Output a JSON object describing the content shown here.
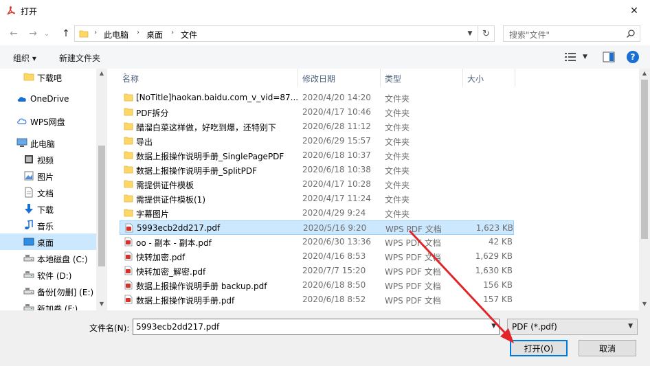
{
  "window": {
    "title": "打开",
    "close_glyph": "✕"
  },
  "nav": {
    "back_glyph": "←",
    "forward_glyph": "→",
    "recent_glyph": "⌄",
    "up_glyph": "↑"
  },
  "address": {
    "crumbs": [
      "此电脑",
      "桌面",
      "文件"
    ],
    "separator": "›",
    "refresh_glyph": "↻"
  },
  "search": {
    "placeholder": "搜索\"文件\""
  },
  "toolbar": {
    "organize_label": "组织 ▾",
    "new_folder_label": "新建文件夹",
    "help_label": "?"
  },
  "sidebar": {
    "items": [
      {
        "label": "下载吧",
        "icon": "folder-icon",
        "indent": 1
      },
      {
        "label": "OneDrive",
        "icon": "cloud-icon",
        "indent": 0
      },
      {
        "label": "WPS网盘",
        "icon": "cloud-outline-icon",
        "indent": 0
      },
      {
        "label": "此电脑",
        "icon": "computer-icon",
        "indent": 0
      },
      {
        "label": "视频",
        "icon": "video-icon",
        "indent": 1
      },
      {
        "label": "图片",
        "icon": "picture-icon",
        "indent": 1
      },
      {
        "label": "文档",
        "icon": "document-icon",
        "indent": 1
      },
      {
        "label": "下载",
        "icon": "download-icon",
        "indent": 1
      },
      {
        "label": "音乐",
        "icon": "music-icon",
        "indent": 1
      },
      {
        "label": "桌面",
        "icon": "desktop-icon",
        "indent": 1,
        "selected": true
      },
      {
        "label": "本地磁盘 (C:)",
        "icon": "drive-icon",
        "indent": 1
      },
      {
        "label": "软件 (D:)",
        "icon": "drive-icon",
        "indent": 1
      },
      {
        "label": "备份[勿删] (E:)",
        "icon": "drive-icon",
        "indent": 1
      },
      {
        "label": "新加卷 (F:)",
        "icon": "drive-icon",
        "indent": 1
      }
    ]
  },
  "columns": {
    "name": "名称",
    "date": "修改日期",
    "type": "类型",
    "size": "大小"
  },
  "files": [
    {
      "name": "[NoTitle]haokan.baidu.com_v_vid=87...",
      "date": "2020/4/20 14:20",
      "type": "文件夹",
      "size": "",
      "kind": "folder"
    },
    {
      "name": "PDF拆分",
      "date": "2020/4/17 10:46",
      "type": "文件夹",
      "size": "",
      "kind": "folder"
    },
    {
      "name": "醋溜白菜这样做，好吃到爆，还特别下",
      "date": "2020/6/28 11:12",
      "type": "文件夹",
      "size": "",
      "kind": "folder"
    },
    {
      "name": "导出",
      "date": "2020/6/29 15:57",
      "type": "文件夹",
      "size": "",
      "kind": "folder"
    },
    {
      "name": "数据上报操作说明手册_SinglePagePDF",
      "date": "2020/6/18 10:37",
      "type": "文件夹",
      "size": "",
      "kind": "folder"
    },
    {
      "name": "数据上报操作说明手册_SplitPDF",
      "date": "2020/6/18 10:38",
      "type": "文件夹",
      "size": "",
      "kind": "folder"
    },
    {
      "name": "需提供证件模板",
      "date": "2020/4/17 10:28",
      "type": "文件夹",
      "size": "",
      "kind": "folder"
    },
    {
      "name": "需提供证件模板(1)",
      "date": "2020/4/17 11:24",
      "type": "文件夹",
      "size": "",
      "kind": "folder"
    },
    {
      "name": "字幕图片",
      "date": "2020/4/29 9:24",
      "type": "文件夹",
      "size": "",
      "kind": "folder"
    },
    {
      "name": "5993ecb2dd217.pdf",
      "date": "2020/5/16 9:20",
      "type": "WPS PDF 文档",
      "size": "1,623 KB",
      "kind": "pdf",
      "selected": true
    },
    {
      "name": "oo - 副本 - 副本.pdf",
      "date": "2020/6/30 13:36",
      "type": "WPS PDF 文档",
      "size": "42 KB",
      "kind": "pdf"
    },
    {
      "name": "快转加密.pdf",
      "date": "2020/4/16 8:53",
      "type": "WPS PDF 文档",
      "size": "1,629 KB",
      "kind": "pdf"
    },
    {
      "name": "快转加密_解密.pdf",
      "date": "2020/7/7 15:20",
      "type": "WPS PDF 文档",
      "size": "1,630 KB",
      "kind": "pdf"
    },
    {
      "name": "数据上报操作说明手册 backup.pdf",
      "date": "2020/6/18 8:50",
      "type": "WPS PDF 文档",
      "size": "156 KB",
      "kind": "pdf"
    },
    {
      "name": "数据上报操作说明手册.pdf",
      "date": "2020/6/18 8:52",
      "type": "WPS PDF 文档",
      "size": "157 KB",
      "kind": "pdf"
    }
  ],
  "footer": {
    "filename_label": "文件名(N):",
    "filename_value": "5993ecb2dd217.pdf",
    "filetype_value": "PDF (*.pdf)",
    "open_label": "打开(O)",
    "cancel_label": "取消"
  },
  "colors": {
    "accent": "#0078d7",
    "selection": "#cce8ff",
    "folder": "#ffd766",
    "pdf_red": "#d8312a",
    "arrow_red": "#e0262b"
  }
}
